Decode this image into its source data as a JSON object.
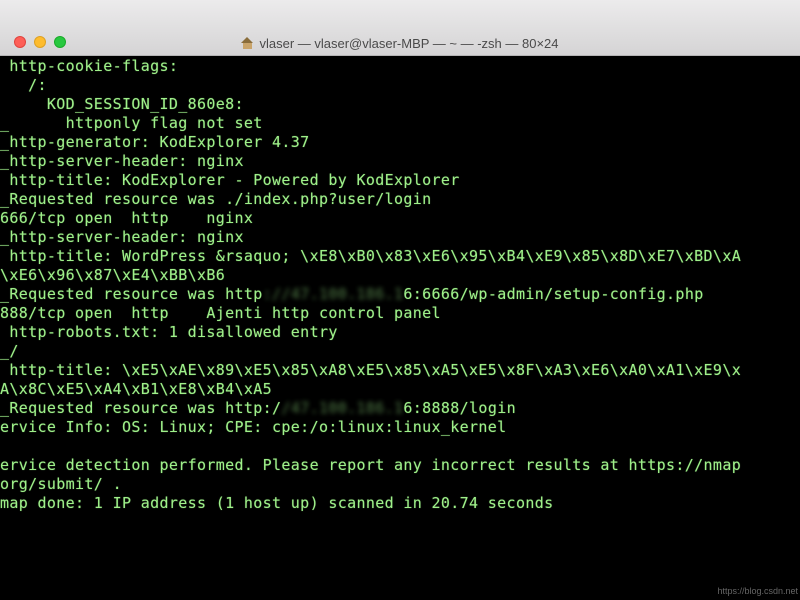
{
  "window": {
    "title": "vlaser — vlaser@vlaser-MBP — ~ — -zsh — 80×24"
  },
  "terminal": {
    "lines": [
      " http-cookie-flags:",
      "   /:",
      "     KOD_SESSION_ID_860e8:",
      "_      httponly flag not set",
      "_http-generator: KodExplorer 4.37",
      "_http-server-header: nginx",
      " http-title: KodExplorer - Powered by KodExplorer",
      "_Requested resource was ./index.php?user/login",
      "666/tcp open  http    nginx",
      "_http-server-header: nginx",
      " http-title: WordPress &rsaquo; \\xE8\\xB0\\x83\\xE6\\x95\\xB4\\xE9\\x85\\x8D\\xE7\\xBD\\xA",
      "\\xE6\\x96\\x87\\xE4\\xBB\\xB6",
      "_Requested resource was http://47.100.186.16:6666/wp-admin/setup-config.php",
      "888/tcp open  http    Ajenti http control panel",
      " http-robots.txt: 1 disallowed entry",
      "_/",
      " http-title: \\xE5\\xAE\\x89\\xE5\\x85\\xA8\\xE5\\x85\\xA5\\xE5\\x8F\\xA3\\xE6\\xA0\\xA1\\xE9\\x",
      "A\\x8C\\xE5\\xA4\\xB1\\xE8\\xB4\\xA5",
      "_Requested resource was http://47.100.186.16:8888/login",
      "ervice Info: OS: Linux; CPE: cpe:/o:linux:linux_kernel",
      "",
      "ervice detection performed. Please report any incorrect results at https://nmap",
      "org/submit/ .",
      "map done: 1 IP address (1 host up) scanned in 20.74 seconds"
    ],
    "blurred": {
      "line12": {
        "pre": "_Requested resource was http",
        "hidden": "://47.100.186.1",
        "post": "6:6666/wp-admin/setup-config.php"
      },
      "line18": {
        "pre": "_Requested resource was http:/",
        "hidden": "/47.100.186.1",
        "post": "6:8888/login"
      }
    }
  },
  "watermark": "https://blog.csdn.net"
}
